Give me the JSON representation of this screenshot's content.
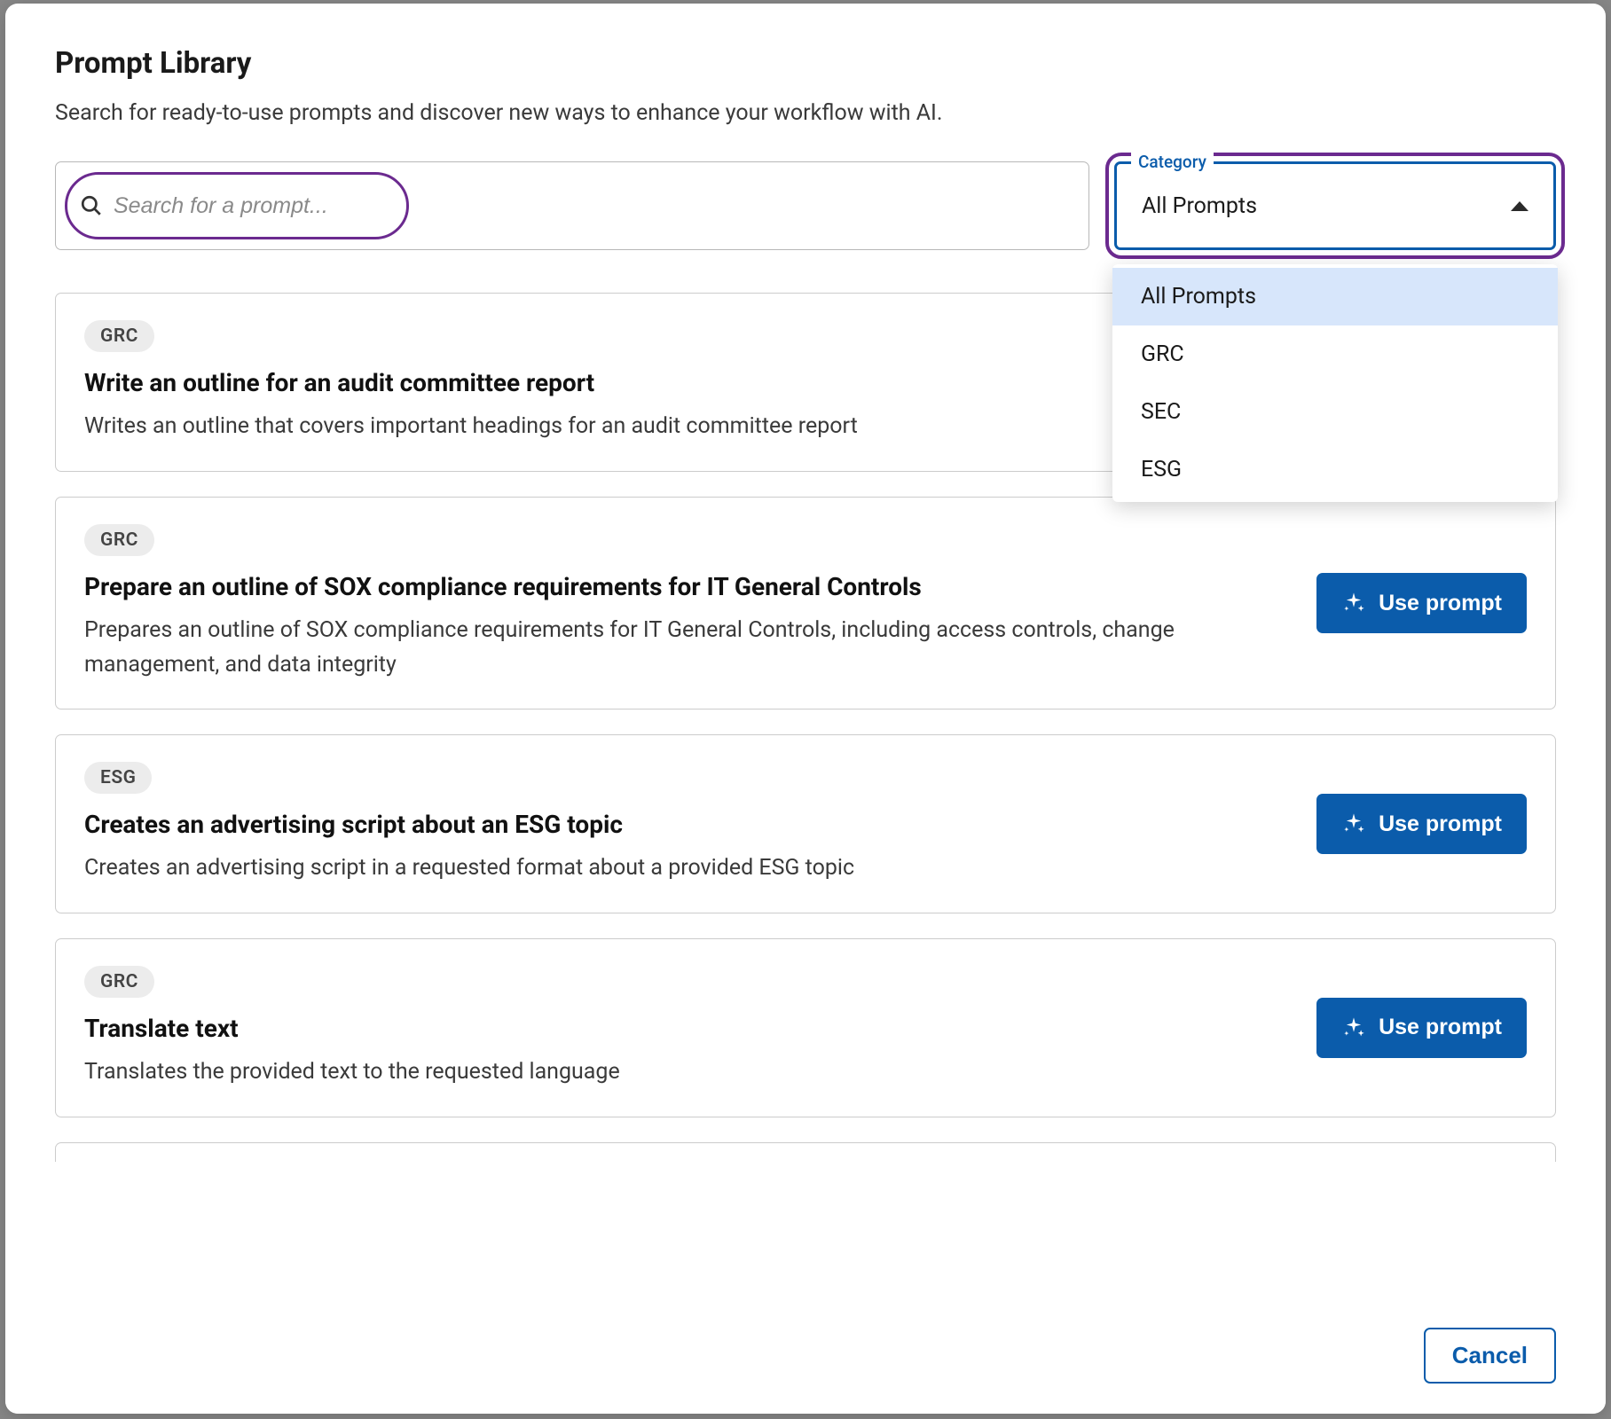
{
  "header": {
    "title": "Prompt Library",
    "subtitle": "Search for ready-to-use prompts and discover new ways to enhance your workflow with AI."
  },
  "search": {
    "placeholder": "Search for a prompt..."
  },
  "category": {
    "label": "Category",
    "selected": "All Prompts",
    "options": [
      "All Prompts",
      "GRC",
      "SEC",
      "ESG"
    ]
  },
  "prompts": [
    {
      "tag": "GRC",
      "title": "Write an outline for an audit committee report",
      "description": "Writes an outline that covers important headings for an audit committee report",
      "show_button": false
    },
    {
      "tag": "GRC",
      "title": "Prepare an outline of SOX compliance requirements for IT General Controls",
      "description": "Prepares an outline of SOX compliance requirements for IT General Controls, including access controls, change management, and data integrity",
      "show_button": true
    },
    {
      "tag": "ESG",
      "title": "Creates an advertising script about an ESG topic",
      "description": "Creates an advertising script in a requested format about a provided ESG topic",
      "show_button": true
    },
    {
      "tag": "GRC",
      "title": "Translate text",
      "description": "Translates the provided text to the requested language",
      "show_button": true
    }
  ],
  "buttons": {
    "use_prompt": "Use prompt",
    "cancel": "Cancel"
  }
}
